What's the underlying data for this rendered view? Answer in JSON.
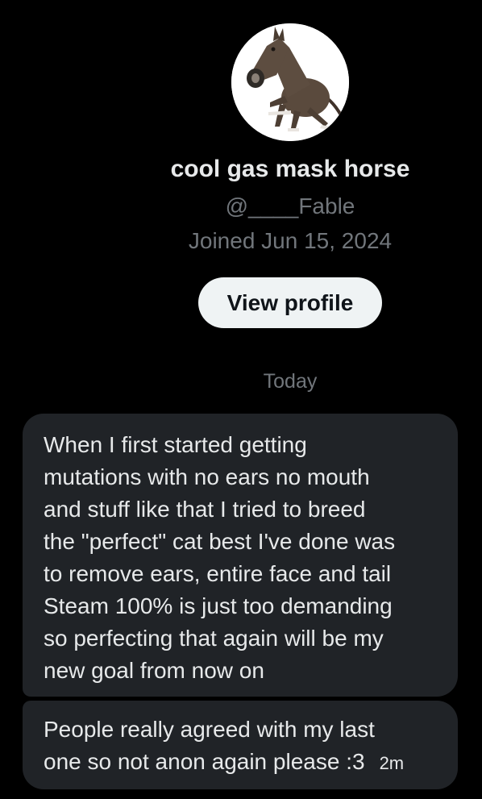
{
  "profile": {
    "avatar_icon": "horse-avatar",
    "display_name": "cool gas mask horse",
    "handle": "@____Fable",
    "joined": "Joined Jun 15, 2024",
    "view_profile_label": "View profile"
  },
  "conversation": {
    "date_divider": "Today",
    "messages": [
      {
        "lines": [
          "When I first started getting",
          "mutations with no ears no mouth",
          "and stuff like that I tried to breed",
          "the \"perfect\" cat best I've done was",
          "to remove ears, entire face and tail",
          "Steam 100% is just too demanding",
          "so perfecting that again will be my",
          "new goal from now on"
        ]
      },
      {
        "lines": [
          "People really agreed with my last",
          "one so not anon again please :3"
        ],
        "time": "2m"
      }
    ]
  },
  "colors": {
    "background": "#000000",
    "bubble": "#202327",
    "primary_text": "#e7e9ea",
    "secondary_text": "#71767b",
    "button_bg": "#eff3f4",
    "button_text": "#0f1419"
  }
}
